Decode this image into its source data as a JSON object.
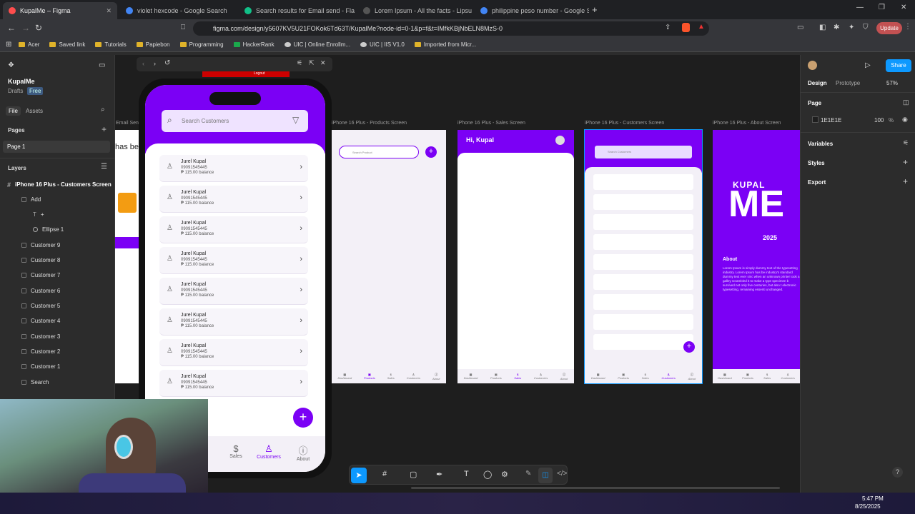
{
  "browser": {
    "tabs": [
      {
        "label": "KupalMe – Figma",
        "color": "#ff4d4d"
      },
      {
        "label": "violet hexcode - Google Search",
        "color": "#4285f4"
      },
      {
        "label": "Search results for Email send - Flatic",
        "color": "#11c088"
      },
      {
        "label": "Lorem Ipsum - All the facts - Lipsum",
        "color": "#555"
      },
      {
        "label": "philippine peso number - Google Se",
        "color": "#4285f4"
      }
    ],
    "url": "figma.com/design/y5607KV5U21FOKok6Td63T/KupalMe?node-id=0-1&p=f&t=IMfkKBjNbELN8MzS-0",
    "update_label": "Update",
    "bookmarks": [
      "Acer",
      "Saved link",
      "Tutorials",
      "Papiebon",
      "Programming",
      "HackerRank",
      "UIC | Online Enrollm...",
      "UIC | IIS V1.0",
      "Imported from Micr..."
    ]
  },
  "figma": {
    "file_name": "KupalMe",
    "drafts": "Drafts",
    "plan": "Free",
    "tab_file": "File",
    "tab_assets": "Assets",
    "pages_label": "Pages",
    "page1": "Page 1",
    "layers_label": "Layers",
    "layers": [
      "iPhone 16 Plus - Customers Screen",
      "Add",
      "+",
      "Ellipse 1",
      "Customer 9",
      "Customer 8",
      "Customer 7",
      "Customer 6",
      "Customer 5",
      "Customer 4",
      "Customer 3",
      "Customer 2",
      "Customer 1",
      "Search"
    ],
    "right": {
      "design": "Design",
      "prototype": "Prototype",
      "zoom": "57%",
      "share": "Share",
      "page": "Page",
      "page_color": "1E1E1E",
      "opacity": "100",
      "pct": "%",
      "variables": "Variables",
      "styles": "Styles",
      "export": "Export"
    }
  },
  "frames": {
    "products_title": "iPhone 16 Plus - Products Screen",
    "sales_title": "iPhone 16 Plus - Sales Screen",
    "customers_title": "iPhone 16 Plus - Customers Screen",
    "about_title": "iPhone 16 Plus - About Screen",
    "email_title": "Email Sen",
    "email_text": "has be",
    "search_product": "Search Product",
    "search_customers": "Search Customers",
    "hi": "Hi, Kupal",
    "kupal": "KUPAL",
    "me": "ME",
    "year": "2025",
    "about": "About",
    "about_text": "Lorem Ipsum is simply dummy text of the typesetting industry. Lorem Ipsum has be industry's standard dummy text ever sinc when an unknown printer took a galley scrambled it to make a type specimen b survived not only five centuries, but also t electronic typesetting, remaining essenti unchanged.",
    "nav": [
      "Dashboard",
      "Products",
      "Sales",
      "Customers",
      "About"
    ]
  },
  "phone": {
    "search_placeholder": "Search Customers",
    "customers": [
      {
        "name": "Jurel Kupal",
        "phone": "09091545445",
        "balance": "₱ 115.00 balance"
      },
      {
        "name": "Jurel Kupal",
        "phone": "09091545445",
        "balance": "₱ 115.00 balance"
      },
      {
        "name": "Jurel Kupal",
        "phone": "09091545445",
        "balance": "₱ 115.00 balance"
      },
      {
        "name": "Jurel Kupal",
        "phone": "09091545445",
        "balance": "₱ 115.00 balance"
      },
      {
        "name": "Jurel Kupal",
        "phone": "09091545445",
        "balance": "₱ 115.00 balance"
      },
      {
        "name": "Jurel Kupal",
        "phone": "09091545445",
        "balance": "₱ 115.00 balance"
      },
      {
        "name": "Jurel Kupal",
        "phone": "09091545445",
        "balance": "₱ 115.00 balance"
      },
      {
        "name": "Jurel Kupal",
        "phone": "09091545445",
        "balance": "₱ 115.00 balance"
      }
    ],
    "nav_sales": "Sales",
    "nav_customers": "Customers",
    "nav_about": "About",
    "logout": "Logout"
  },
  "taskbar": {
    "time": "5:47 PM",
    "date": "8/25/2025"
  },
  "colors": {
    "accent": "#7b00f5",
    "figma_blue": "#0d99ff"
  }
}
